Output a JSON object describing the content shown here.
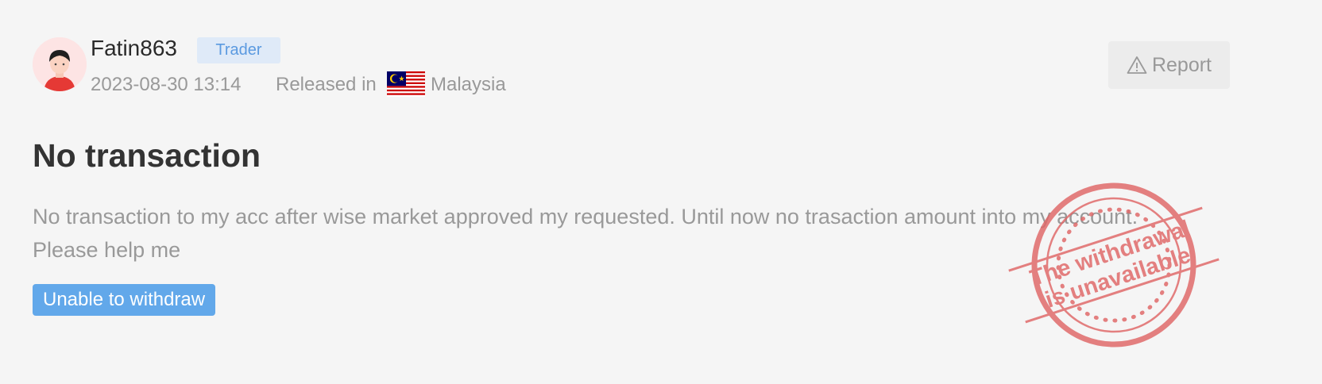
{
  "post": {
    "username": "Fatin863",
    "role": "Trader",
    "date": "2023-08-30 13:14",
    "released_label": "Released in",
    "country": "Malaysia",
    "report_label": "Report",
    "title": "No transaction",
    "body": "No transaction to my acc after wise market approved my requested. Until now no trasaction amount into my account. Please help me",
    "tag": "Unable to withdraw"
  },
  "stamp": {
    "line1": "The withdrawal",
    "line2": "is unavailable",
    "color": "#e06666"
  },
  "icons": {
    "avatar": "user-avatar-icon",
    "flag": "malaysia-flag-icon",
    "report": "warning-triangle-icon"
  },
  "colors": {
    "accent": "#62a8ea",
    "badge_bg": "#dfeaf8",
    "badge_text": "#5b9ae0"
  }
}
